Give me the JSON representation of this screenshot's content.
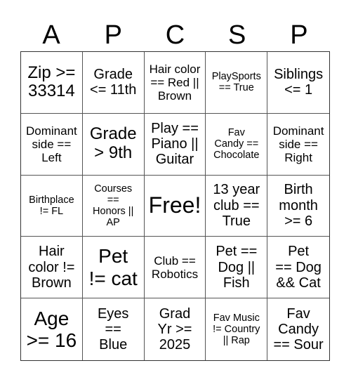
{
  "header": {
    "letters": [
      "A",
      "P",
      "C",
      "S",
      "P"
    ]
  },
  "grid": {
    "rows": [
      [
        {
          "text": "Zip >=\n33314",
          "size": "s-l"
        },
        {
          "text": "Grade\n<= 11th",
          "size": "s-m"
        },
        {
          "text": "Hair color\n== Red ||\nBrown",
          "size": "s-s"
        },
        {
          "text": "PlaySports\n== True",
          "size": "s-xs"
        },
        {
          "text": "Siblings\n<= 1",
          "size": "s-m"
        }
      ],
      [
        {
          "text": "Dominant\nside ==\nLeft",
          "size": "s-s"
        },
        {
          "text": "Grade\n> 9th",
          "size": "s-l"
        },
        {
          "text": "Play ==\nPiano ||\nGuitar",
          "size": "s-m"
        },
        {
          "text": "Fav\nCandy ==\nChocolate",
          "size": "s-xs"
        },
        {
          "text": "Dominant\nside ==\nRight",
          "size": "s-s"
        }
      ],
      [
        {
          "text": "Birthplace\n!= FL",
          "size": "s-xs"
        },
        {
          "text": "Courses\n==\nHonors ||\nAP",
          "size": "s-xs"
        },
        {
          "text": "Free!",
          "size": "s-free"
        },
        {
          "text": "13 year\nclub ==\nTrue",
          "size": "s-m"
        },
        {
          "text": "Birth\nmonth\n>= 6",
          "size": "s-m"
        }
      ],
      [
        {
          "text": "Hair\ncolor !=\nBrown",
          "size": "s-m"
        },
        {
          "text": "Pet\n!= cat",
          "size": "s-xl"
        },
        {
          "text": "Club ==\nRobotics",
          "size": "s-s"
        },
        {
          "text": "Pet ==\nDog ||\nFish",
          "size": "s-m"
        },
        {
          "text": "Pet\n== Dog\n&& Cat",
          "size": "s-m"
        }
      ],
      [
        {
          "text": "Age\n>= 16",
          "size": "s-xl"
        },
        {
          "text": "Eyes\n==\nBlue",
          "size": "s-m"
        },
        {
          "text": "Grad\nYr >=\n2025",
          "size": "s-m"
        },
        {
          "text": "Fav Music\n!= Country\n|| Rap",
          "size": "s-xs"
        },
        {
          "text": "Fav\nCandy\n== Sour",
          "size": "s-m"
        }
      ]
    ]
  }
}
